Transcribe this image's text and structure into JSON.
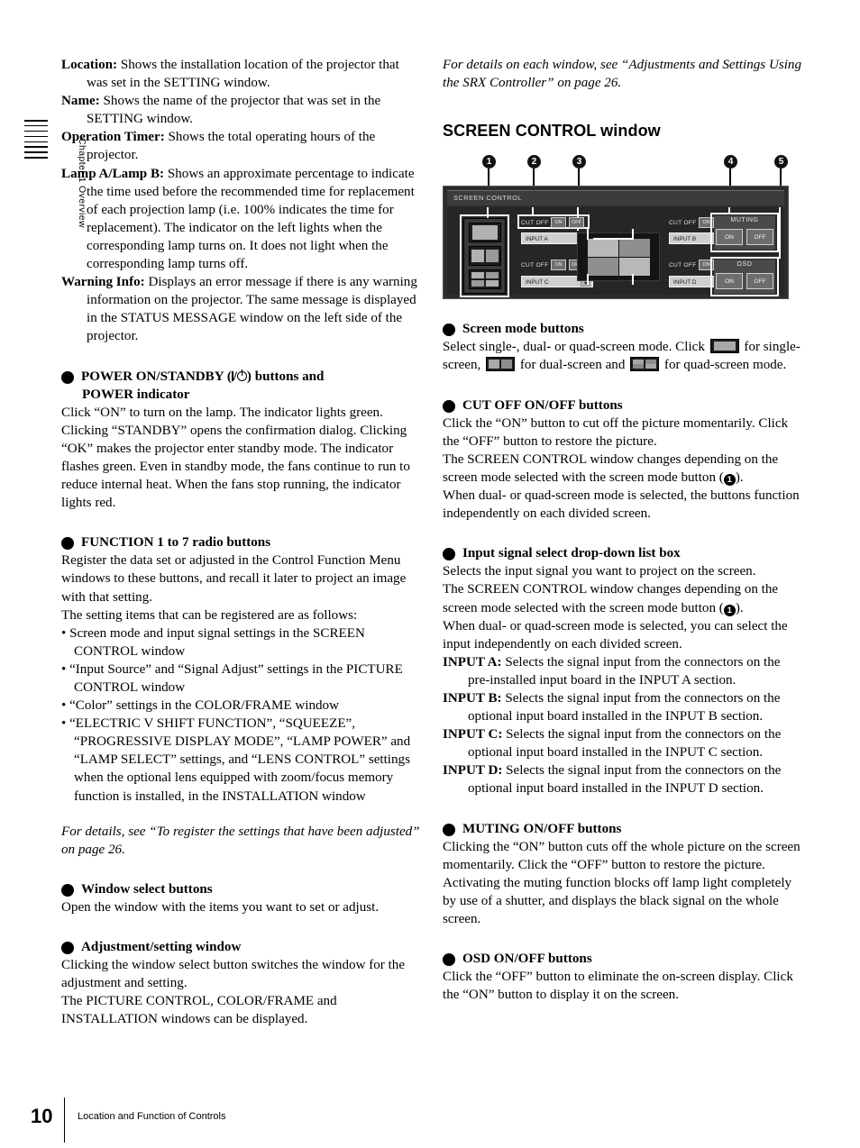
{
  "chapter_tab": {
    "label": "Chapter 1  Overview"
  },
  "footer": {
    "page_number": "10",
    "running_head": "Location and Function of Controls"
  },
  "left_column": {
    "definitions": [
      {
        "term": "Location:",
        "text": " Shows the installation location of the projector that was set in the SETTING window."
      },
      {
        "term": "Name:",
        "text": " Shows the name of the projector that was set in the SETTING window."
      },
      {
        "term": "Operation Timer:",
        "text": " Shows the total operating hours of the projector."
      },
      {
        "term": "Lamp A/Lamp B:",
        "text": " Shows an approximate percentage to indicate the time used before the recommended time for replacement of each projection lamp (i.e. 100% indicates the time for replacement). The indicator on the left lights when the corresponding lamp turns on. It does not light when the corresponding lamp turns off."
      },
      {
        "term": "Warning Info:",
        "text": " Displays an error message if there is any warning information on the projector. The same message is displayed in the STATUS MESSAGE window on the left side of the projector."
      }
    ],
    "item4": {
      "number": "4",
      "heading_part1": "POWER ON/STANDBY (",
      "heading_part2": ") buttons and",
      "heading_line2": "POWER indicator",
      "body": "Click “ON” to turn on the lamp. The indicator lights green. Clicking “STANDBY” opens the confirmation dialog. Clicking “OK” makes the projector enter standby mode. The indicator flashes green. Even in standby mode, the fans continue to run to reduce internal heat. When the fans stop running, the indicator lights red."
    },
    "item5": {
      "number": "5",
      "heading": "FUNCTION 1 to 7 radio buttons",
      "body": "Register the data set or adjusted in the Control Function Menu windows to these buttons, and recall it later to project an image with that setting.",
      "body2": "The setting items that can be registered are as follows:",
      "bullets": [
        "Screen mode and input signal settings in the SCREEN CONTROL window",
        "“Input Source” and “Signal Adjust” settings in the PICTURE CONTROL window",
        "“Color” settings in the COLOR/FRAME window",
        "“ELECTRIC V SHIFT FUNCTION”, “SQUEEZE”, “PROGRESSIVE DISPLAY MODE”, “LAMP POWER” and “LAMP SELECT” settings, and “LENS CONTROL” settings when the optional lens equipped with zoom/focus memory function is installed, in the INSTALLATION window"
      ],
      "note": "For details, see “To register the settings that have been adjusted” on page 26."
    },
    "item6": {
      "number": "6",
      "heading": "Window select buttons",
      "body": "Open the window with the items you want to set or adjust."
    },
    "item7": {
      "number": "7",
      "heading": "Adjustment/setting window",
      "body": "Clicking the window select button switches the window for the adjustment and setting.",
      "body2": "The PICTURE CONTROL, COLOR/FRAME and INSTALLATION windows can be displayed."
    }
  },
  "right_column": {
    "intro_note": "For details on each window, see “Adjustments and Settings Using the SRX Controller” on page 26.",
    "section_heading": "SCREEN CONTROL window",
    "item1": {
      "number": "1",
      "heading": "Screen mode buttons",
      "text_a": "Select single-, dual- or quad-screen mode. Click ",
      "text_b": " for single-screen, ",
      "text_c": " for dual-screen and ",
      "text_d": " for quad-screen mode."
    },
    "item2": {
      "number": "2",
      "heading": "CUT OFF ON/OFF buttons",
      "body_a": "Click the “ON” button to cut off the picture momentarily. Click the “OFF” button to restore the picture.",
      "body_b": "The SCREEN CONTROL window changes depending on the screen mode selected with the screen mode button (",
      "body_c": ").",
      "body_d": "When dual- or quad-screen mode is selected, the buttons function independently on each divided screen.",
      "inline_ref": "1"
    },
    "item3": {
      "number": "3",
      "heading": "Input signal select drop-down list box",
      "body_a": "Selects the input signal you want to project on the screen.",
      "body_b": "The SCREEN CONTROL window changes depending on the screen mode selected with the screen mode button (",
      "body_c": ").",
      "body_d": "When dual- or quad-screen mode is selected, you can select the input independently on each divided screen.",
      "inline_ref": "1",
      "inputs": [
        {
          "term": "INPUT A:",
          "text": " Selects the signal input from the connectors on the pre-installed input board in the INPUT A section."
        },
        {
          "term": "INPUT B:",
          "text": " Selects the signal input from the connectors on the optional input board installed in the INPUT B section."
        },
        {
          "term": "INPUT C:",
          "text": " Selects the signal input from the connectors on the optional input board installed in the INPUT C section."
        },
        {
          "term": "INPUT D:",
          "text": " Selects the signal input from the connectors on the optional input board installed in the INPUT D section."
        }
      ]
    },
    "item4": {
      "number": "4",
      "heading": "MUTING ON/OFF buttons",
      "body": "Clicking the “ON” button cuts off the whole picture on the screen momentarily. Click the “OFF” button to restore the picture. Activating the muting function blocks off lamp light completely by use of a shutter, and displays the black signal on the whole screen."
    },
    "item5": {
      "number": "5",
      "heading": "OSD ON/OFF buttons",
      "body": "Click the “OFF” button to eliminate the on-screen display. Click the “ON” button to display it on the screen."
    }
  },
  "figure": {
    "callout_numbers": [
      "1",
      "2",
      "3",
      "4",
      "5"
    ],
    "window_title": "SCREEN CONTROL",
    "cut_off_label": "CUT OFF",
    "on_label": "ON",
    "off_label": "OFF",
    "inputs": [
      "INPUT A",
      "INPUT B",
      "INPUT C",
      "INPUT D"
    ],
    "muting": {
      "title": "MUTING",
      "on": "ON",
      "off": "OFF"
    },
    "osd": {
      "title": "OSD",
      "on": "ON",
      "off": "OFF"
    }
  }
}
